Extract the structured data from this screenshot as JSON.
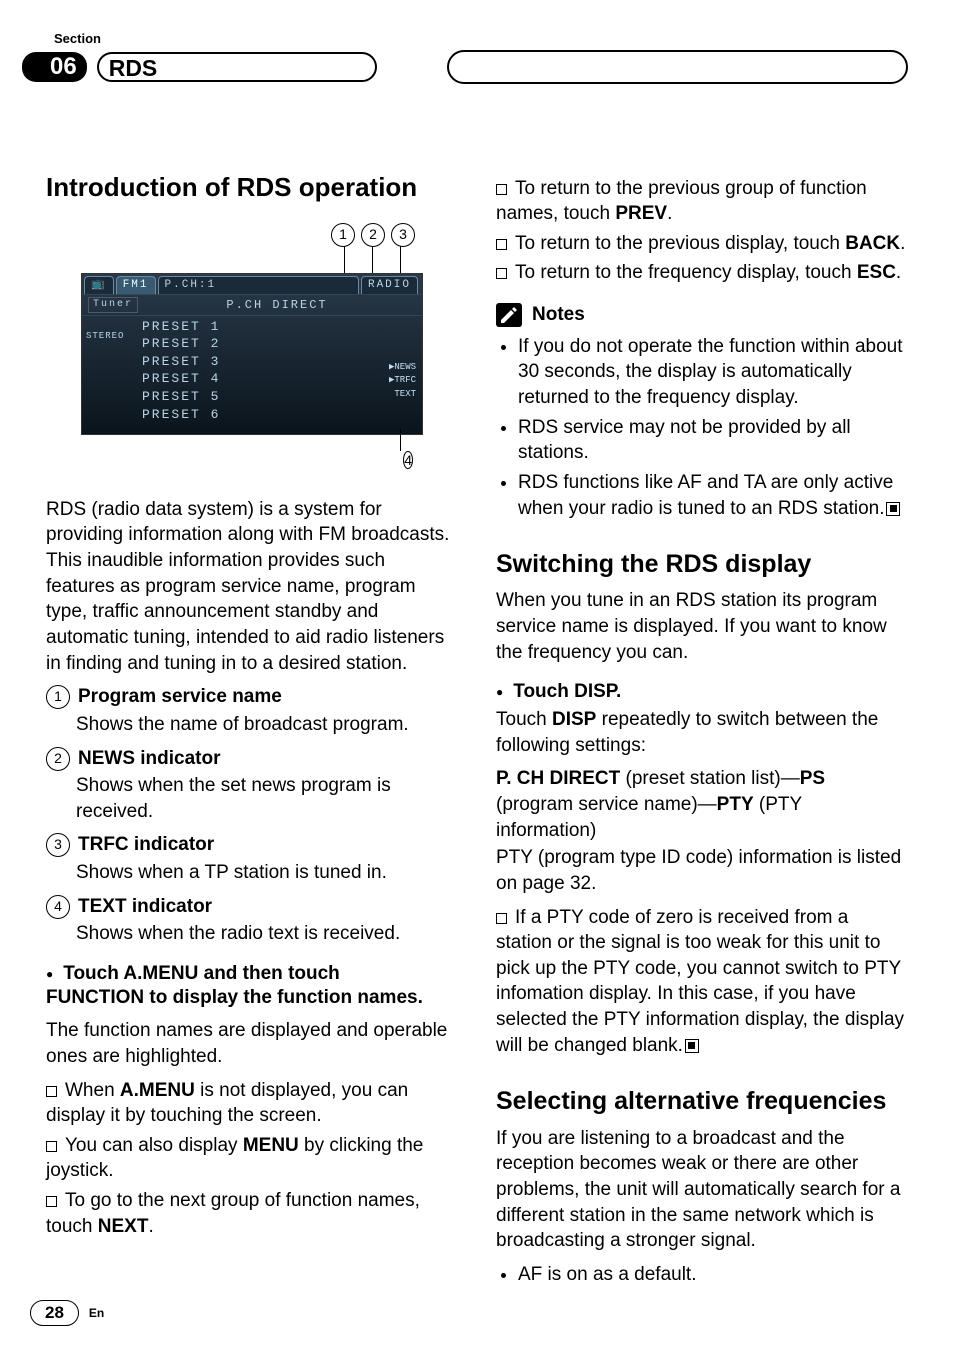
{
  "header": {
    "section_label": "Section",
    "number": "06",
    "chapter": "RDS"
  },
  "left": {
    "h1": "Introduction of RDS operation",
    "callouts": {
      "c1": "1",
      "c2": "2",
      "c3": "3",
      "c4": "4"
    },
    "screen": {
      "tab_icon": "📺",
      "tab_fm": "FM1",
      "tab_pch": "P.CH:1",
      "tab_radio": "RADIO",
      "tuner": "Tuner",
      "pch_direct": "P.CH DIRECT",
      "stereo": "STEREO",
      "presets": [
        "PRESET 1",
        "PRESET 2",
        "PRESET 3",
        "PRESET 4",
        "PRESET 5",
        "PRESET 6"
      ],
      "indics": [
        "▶NEWS",
        "▶TRFC",
        "TEXT"
      ]
    },
    "intro_p": "RDS (radio data system) is a system for providing information along with FM broadcasts. This inaudible information provides such features as program service name, program type, traffic announcement standby and automatic tuning, intended to aid radio listeners in finding and tuning in to a desired station.",
    "items": [
      {
        "n": "1",
        "title": "Program service name",
        "body": "Shows the name of broadcast program."
      },
      {
        "n": "2",
        "title": "NEWS indicator",
        "body": "Shows when the set news program is received."
      },
      {
        "n": "3",
        "title": "TRFC indicator",
        "body": "Shows when a TP station is tuned in."
      },
      {
        "n": "4",
        "title": "TEXT indicator",
        "body": "Shows when the radio text is received."
      }
    ],
    "step_head_a": "Touch A.MENU and then touch",
    "step_head_b": "FUNCTION to display the function names.",
    "step_body": "The function names are displayed and operable ones are highlighted.",
    "when_amenu_a": "When ",
    "when_amenu_b": "A.MENU",
    "when_amenu_c": " is not displayed, you can display it by touching the screen.",
    "also_menu_a": "You can also display ",
    "also_menu_b": "MENU",
    "also_menu_c": " by clicking the joystick.",
    "next_a": "To go to the next group of function names, touch ",
    "next_b": "NEXT",
    "next_c": "."
  },
  "right": {
    "prev_a": "To return to the previous group of function names, touch ",
    "prev_b": "PREV",
    "prev_c": ".",
    "back_a": "To return to the previous display, touch ",
    "back_b": "BACK",
    "back_c": ".",
    "esc_a": "To return to the frequency display, touch ",
    "esc_b": "ESC",
    "esc_c": ".",
    "notes_label": "Notes",
    "notes": [
      "If you do not operate the function within about 30 seconds, the display is automatically returned to the frequency display.",
      "RDS service may not be provided by all stations."
    ],
    "note3": "RDS functions like AF and TA are only active when your radio is tuned to an RDS station.",
    "h2a": "Switching the RDS display",
    "sw_intro": "When you tune in an RDS station its program service name is displayed. If you want to know the frequency you can.",
    "touch_disp": "Touch DISP.",
    "disp_body_a": "Touch ",
    "disp_body_b": "DISP",
    "disp_body_c": " repeatedly to switch between the following settings:",
    "seq_a": "P. CH DIRECT",
    "seq_b": " (preset station list)—",
    "seq_c": "PS",
    "seq_d": " (program service name)—",
    "seq_e": "PTY",
    "seq_f": " (PTY information)",
    "seq_g": "PTY (program type ID code) information is listed on page 32.",
    "pty_zero": "If a PTY code of zero is received from a station or the signal is too weak for this unit to pick up the PTY code, you cannot switch to PTY infomation display. In this case, if you have selected the PTY information display, the display will be changed blank.",
    "h2b": "Selecting alternative frequencies",
    "af_intro": "If you are listening to a broadcast and the reception becomes weak or there are other problems, the unit will automatically search for a different station in the same network which is broadcasting a stronger signal.",
    "af_default": "AF is on as a default."
  },
  "footer": {
    "page": "28",
    "lang": "En"
  }
}
